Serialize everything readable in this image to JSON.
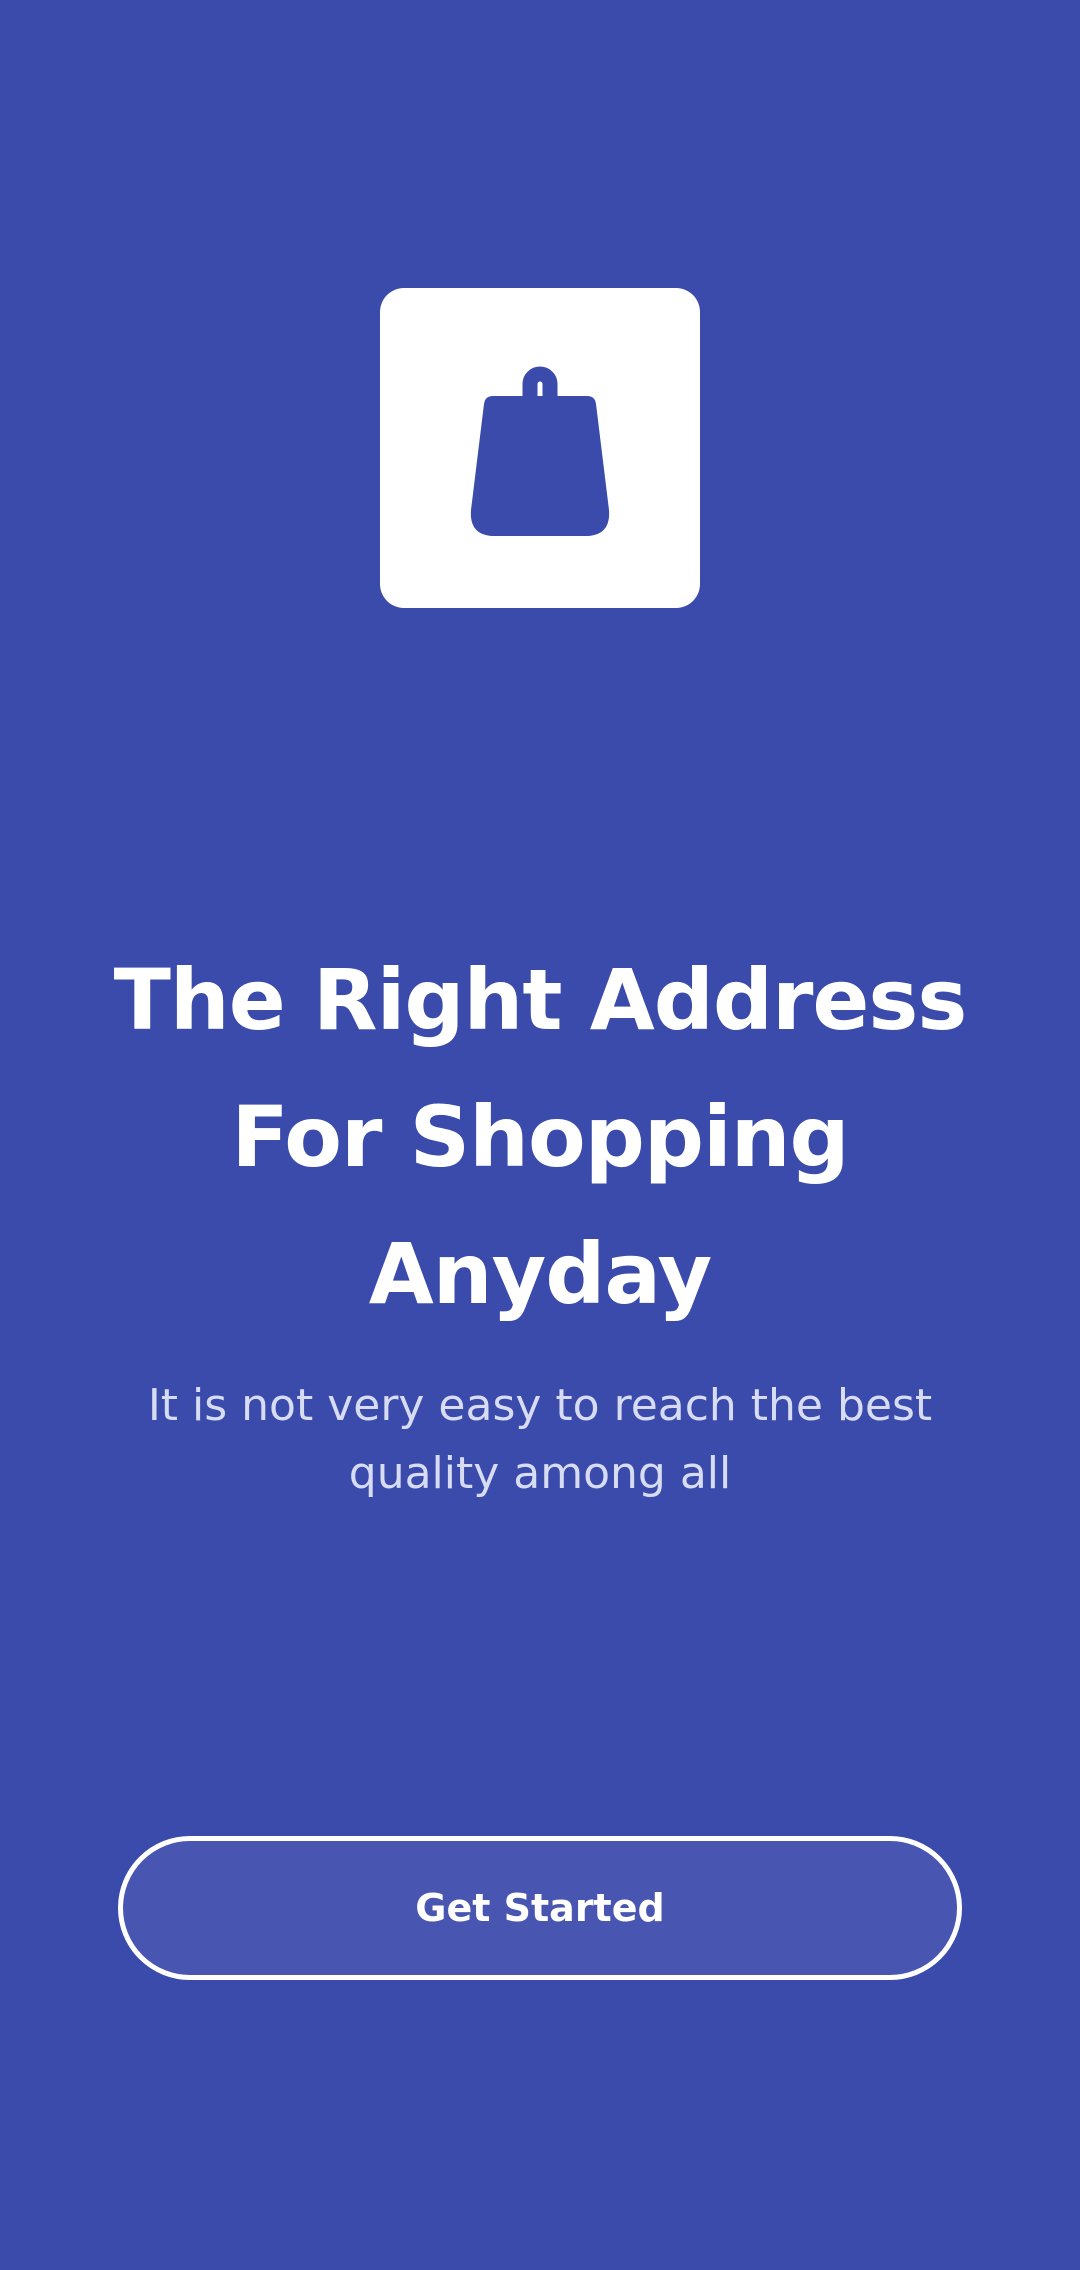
{
  "theme": {
    "background": "#3A4BAB",
    "accent": "#FFFFFF",
    "button_fill": "#4856B1",
    "subtitle_color": "#D7DCF2"
  },
  "logo": {
    "icon": "shopping-bag-icon"
  },
  "onboarding": {
    "headline_lines": [
      "The Right Address",
      "For Shopping",
      "Anyday"
    ],
    "subtitle_lines": [
      "It is not very easy to reach the best",
      "quality among all"
    ]
  },
  "cta": {
    "label": "Get Started"
  }
}
